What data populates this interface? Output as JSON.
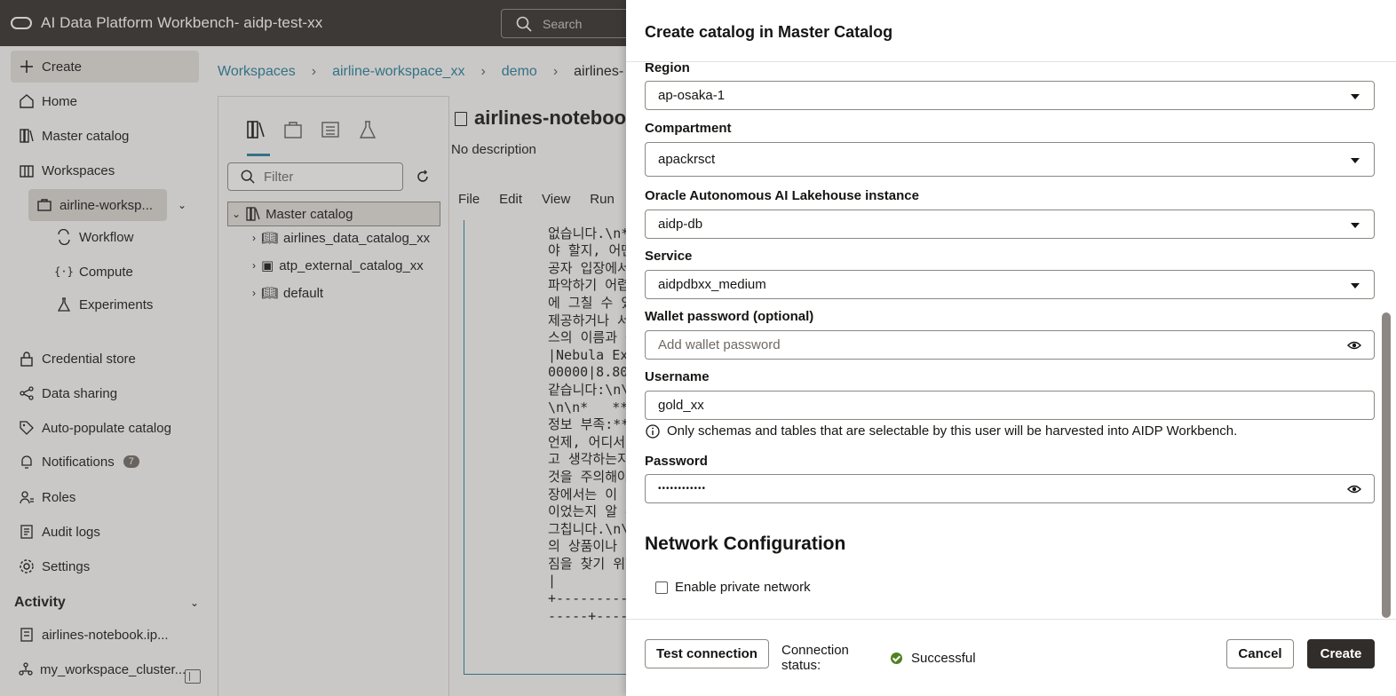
{
  "app": {
    "title": "AI Data Platform Workbench- aidp-test-xx",
    "search_placeholder": "Search"
  },
  "sidebar": {
    "create_label": "Create",
    "items": [
      {
        "label": "Home",
        "icon": "home-icon"
      },
      {
        "label": "Master catalog",
        "icon": "catalog-icon"
      },
      {
        "label": "Workspaces",
        "icon": "workspaces-icon"
      }
    ],
    "workspace": {
      "label": "airline-worksp...",
      "icon": "briefcase-icon"
    },
    "workspace_items": [
      {
        "label": "Workflow",
        "icon": "workflow-icon"
      },
      {
        "label": "Compute",
        "icon": "compute-icon"
      },
      {
        "label": "Experiments",
        "icon": "flask-icon"
      }
    ],
    "items2": [
      {
        "label": "Credential store",
        "icon": "lock-icon"
      },
      {
        "label": "Data sharing",
        "icon": "share-icon"
      },
      {
        "label": "Auto-populate catalog",
        "icon": "tag-icon"
      },
      {
        "label": "Notifications",
        "icon": "bell-icon",
        "badge": "7"
      },
      {
        "label": "Roles",
        "icon": "roles-icon"
      },
      {
        "label": "Audit logs",
        "icon": "audit-icon"
      },
      {
        "label": "Settings",
        "icon": "gear-icon"
      }
    ],
    "activity_title": "Activity",
    "activity_items": [
      {
        "label": "airlines-notebook.ip...",
        "icon": "notebook-icon"
      },
      {
        "label": "my_workspace_cluster...",
        "icon": "cluster-icon"
      }
    ]
  },
  "breadcrumb": {
    "items": [
      "Workspaces",
      "airline-workspace_xx",
      "demo"
    ],
    "current": "airlines-"
  },
  "explorer": {
    "filter_placeholder": "Filter",
    "root": "Master catalog",
    "children": [
      "airlines_data_catalog_xx",
      "atp_external_catalog_xx",
      "default"
    ]
  },
  "notebook": {
    "title": "airlines-notebook",
    "description": "No description",
    "menu": [
      "File",
      "Edit",
      "View",
      "Run"
    ],
    "code_lines": [
      "없습니다.\\n*",
      "야 할지, 어떤",
      "공자 입장에서",
      "파악하기 어렵",
      "에 그칠 수 있",
      "제공하거나 서",
      "스의 이름과 구",
      "|Nebula Ex",
      "00000|8.80",
      "같습니다:\\n\\",
      "\\n\\n*   **",
      "정보 부족:**",
      "언제, 어디서,",
      "고 생각하는지",
      "것을 주의해야",
      "장에서는 이 러",
      "이었는지 알 수",
      "그칩니다.\\n\\",
      "의 상품이나 서",
      "짐을 찾기 위한",
      "|",
      "+----------",
      "-----+----"
    ]
  },
  "drawer": {
    "title": "Create catalog in Master Catalog",
    "region_label": "Region",
    "region_value": "ap-osaka-1",
    "compartment_label": "Compartment",
    "compartment_value": "apackrsct",
    "instance_label": "Oracle Autonomous AI Lakehouse instance",
    "instance_value": "aidp-db",
    "service_label": "Service",
    "service_value": "aidpdbxx_medium",
    "wallet_label": "Wallet password (optional)",
    "wallet_placeholder": "Add wallet password",
    "username_label": "Username",
    "username_value": "gold_xx",
    "username_helper": "Only schemas and tables that are selectable by this user will be harvested into AIDP Workbench.",
    "password_label": "Password",
    "password_value": "••••••••••••",
    "network_title": "Network Configuration",
    "private_network_label": "Enable private network",
    "private_network_checked": false
  },
  "footer": {
    "test_connection_label": "Test connection",
    "connection_status_label": "Connection status:",
    "connection_status_value": "Successful",
    "cancel_label": "Cancel",
    "create_label": "Create"
  },
  "colors": {
    "header_bg": "#312d2a",
    "link": "#227e9e",
    "success": "#508223",
    "primary_button": "#312d2a"
  }
}
